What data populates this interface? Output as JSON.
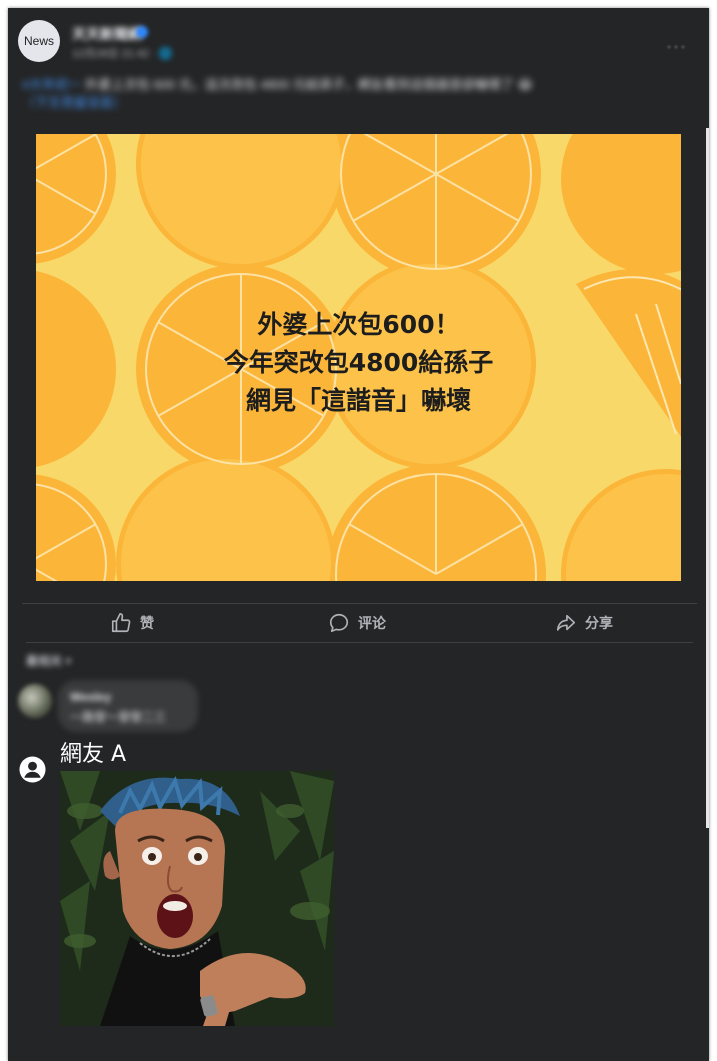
{
  "post": {
    "avatar_text": "News",
    "page_name": "天天新聞網",
    "timestamp": "12月28日 21:42 · 🌐",
    "more_icon": "more-horizontal-icon",
    "text_link": "#大年初一",
    "text_body": "外婆上次包 600 元，這次改包 4800 元給孫子，網友看到這個諧音卻嚇壞了 😂",
    "text_more": "（下文見留言區）",
    "image": {
      "headline_lines": [
        "外婆上次包600！",
        "今年突改包4800給孫子",
        "網見「這諧音」嚇壞"
      ]
    }
  },
  "actions": {
    "like_label": "赞",
    "comment_label": "评论",
    "share_label": "分享",
    "like_icon": "thumbs-up-icon",
    "comment_icon": "comment-bubble-icon",
    "share_icon": "share-arrow-icon"
  },
  "comments": {
    "sort_label": "最相关 ▾",
    "items": [
      {
        "name": "Wesley",
        "text": "一路發～發發二三"
      },
      {
        "name": "網友 A",
        "image": "shocked-man-meme"
      }
    ]
  },
  "colors": {
    "background": "#242526",
    "text_secondary": "#b0b3b8",
    "link": "#4599ff",
    "image_yellow": "#f9d86a",
    "image_orange": "#fbb63a"
  }
}
